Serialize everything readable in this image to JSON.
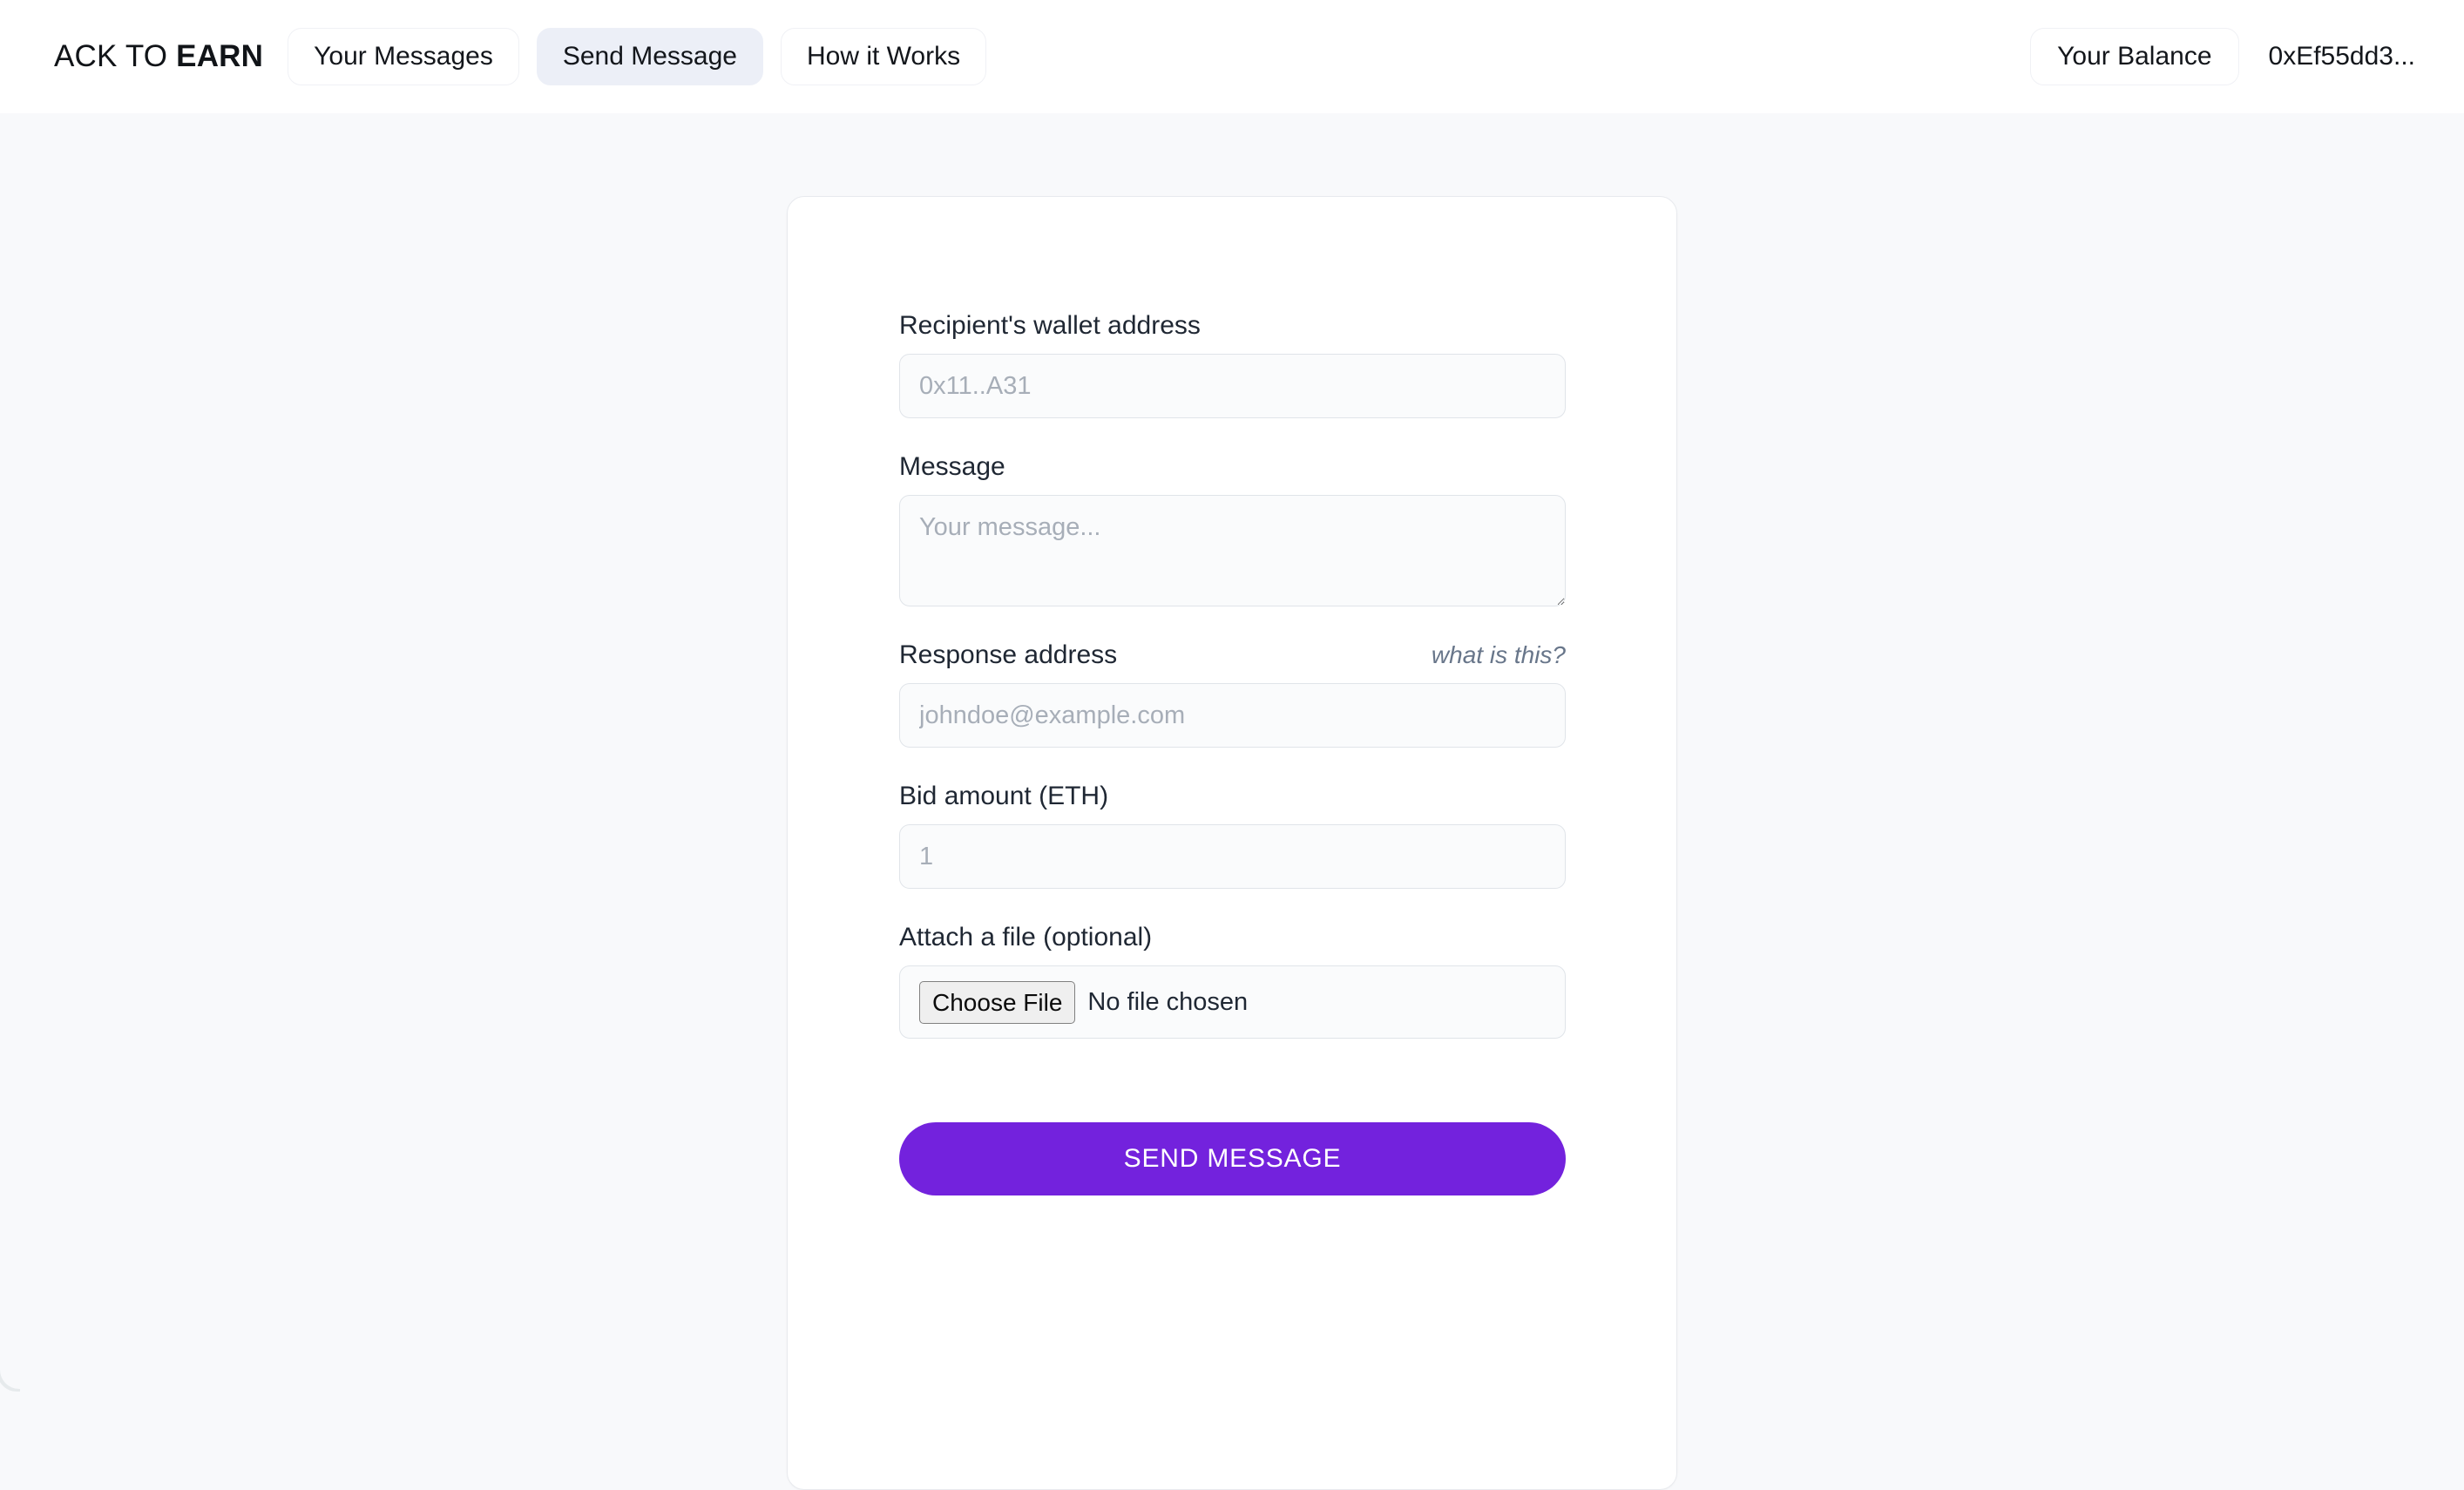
{
  "header": {
    "logo_prefix": "ACK TO ",
    "logo_strong": "EARN",
    "nav": [
      {
        "label": "Your Messages",
        "active": false
      },
      {
        "label": "Send Message",
        "active": true
      },
      {
        "label": "How it Works",
        "active": false
      }
    ],
    "balance_label": "Your Balance",
    "wallet_address": "0xEf55dd3..."
  },
  "form": {
    "recipient": {
      "label": "Recipient's wallet address",
      "placeholder": "0x11..A31",
      "value": ""
    },
    "message": {
      "label": "Message",
      "placeholder": "Your message...",
      "value": ""
    },
    "response_address": {
      "label": "Response address",
      "helper_link": "what is this?",
      "placeholder": "johndoe@example.com",
      "value": ""
    },
    "bid_amount": {
      "label": "Bid amount (ETH)",
      "placeholder": "1",
      "value": ""
    },
    "attachment": {
      "label": "Attach a file (optional)",
      "button_label": "Choose File",
      "status": "No file chosen"
    },
    "submit_label": "SEND MESSAGE"
  },
  "colors": {
    "accent": "#7322dd",
    "page_background": "#f8f9fb",
    "card_background": "#ffffff",
    "active_tab_background": "#eceff7",
    "input_background": "#fafbfc",
    "input_border": "#e0e4e9",
    "label_text": "#1f2733",
    "placeholder_text": "#a7aeb8",
    "helper_link_text": "#68768a"
  }
}
